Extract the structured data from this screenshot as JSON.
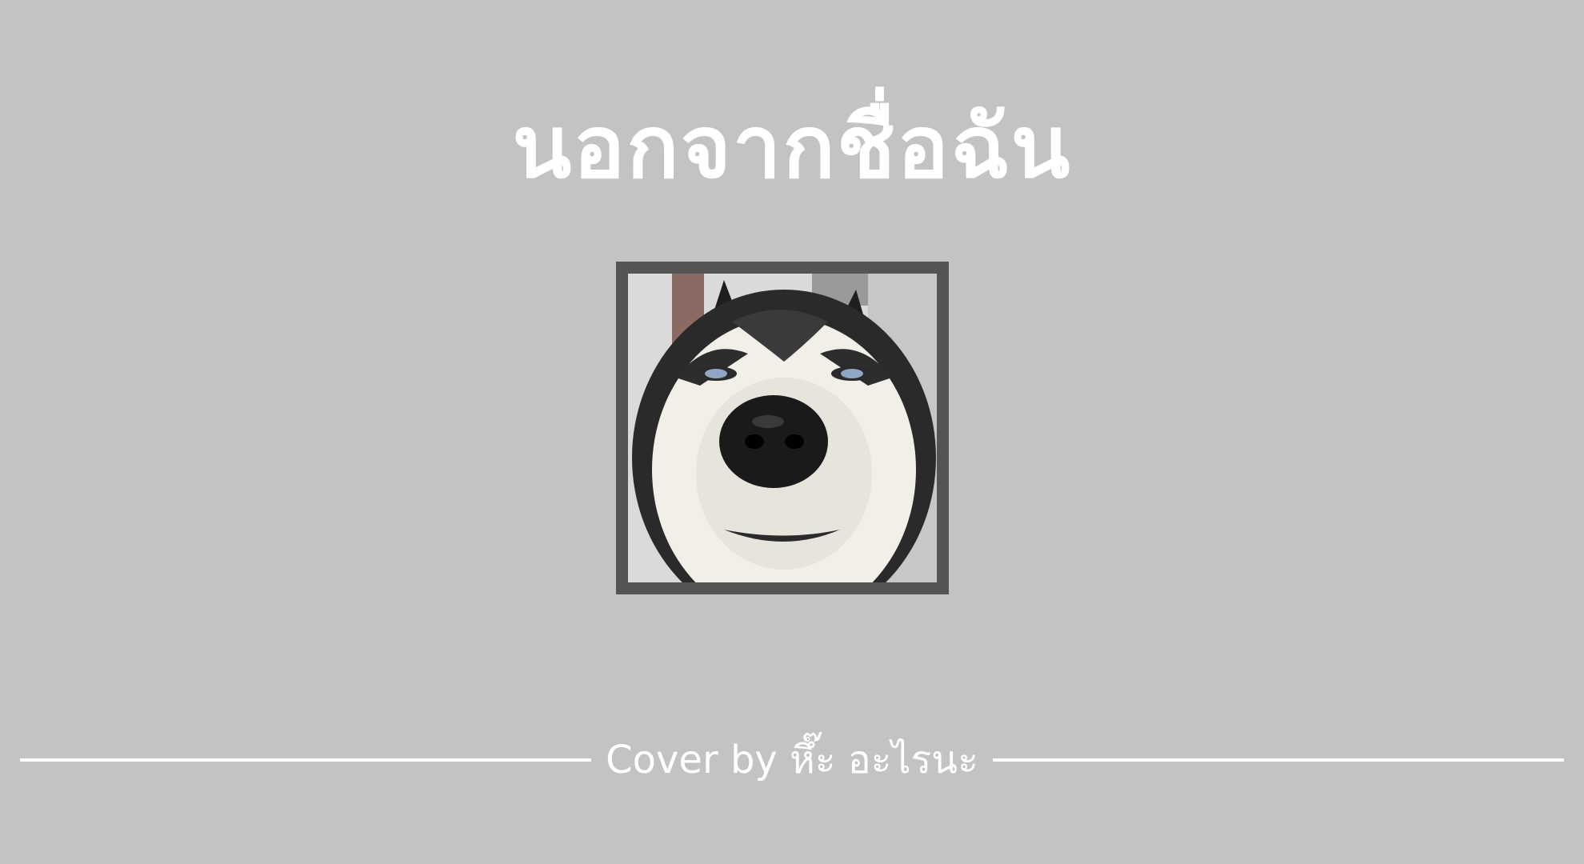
{
  "title": "นอกจากชื่อฉัน",
  "cover": {
    "subject": "husky-dog-face-photo"
  },
  "footer": {
    "credit": "Cover by หึ๊ะ อะไรนะ"
  },
  "colors": {
    "background": "#c3c3c3",
    "text": "#ffffff",
    "frame": "#545454"
  }
}
